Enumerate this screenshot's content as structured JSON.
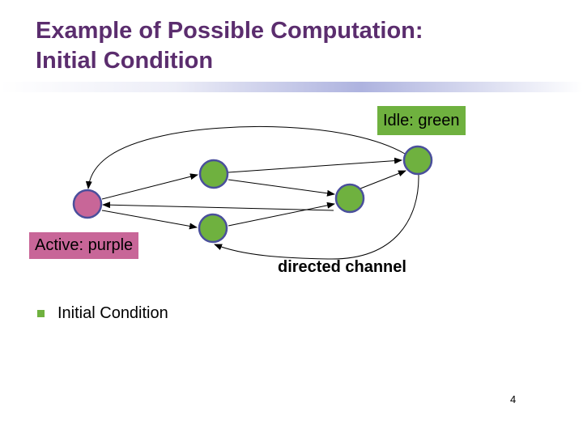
{
  "slide": {
    "title_line1": "Example of Possible Computation:",
    "title_line2": "Initial Condition",
    "page_number": "4"
  },
  "legend": {
    "idle": {
      "label": "Idle: green",
      "color": "#6fb13f"
    },
    "active": {
      "label": "Active: purple",
      "color": "#c86698"
    }
  },
  "diagram": {
    "edge_label": "directed channel",
    "node_border_color": "#4a4f9c",
    "nodes": [
      {
        "id": "a",
        "state": "active"
      },
      {
        "id": "b",
        "state": "idle"
      },
      {
        "id": "c",
        "state": "idle"
      },
      {
        "id": "d",
        "state": "idle"
      },
      {
        "id": "e",
        "state": "idle"
      }
    ],
    "edges": [
      {
        "from": "a",
        "to": "b"
      },
      {
        "from": "a",
        "to": "c"
      },
      {
        "from": "b",
        "to": "d"
      },
      {
        "from": "b",
        "to": "e"
      },
      {
        "from": "c",
        "to": "d"
      },
      {
        "from": "d",
        "to": "a"
      },
      {
        "from": "d",
        "to": "e"
      },
      {
        "from": "e",
        "to": "a"
      },
      {
        "from": "e",
        "to": "c"
      }
    ]
  },
  "bullets": [
    {
      "text": "Initial Condition"
    }
  ]
}
